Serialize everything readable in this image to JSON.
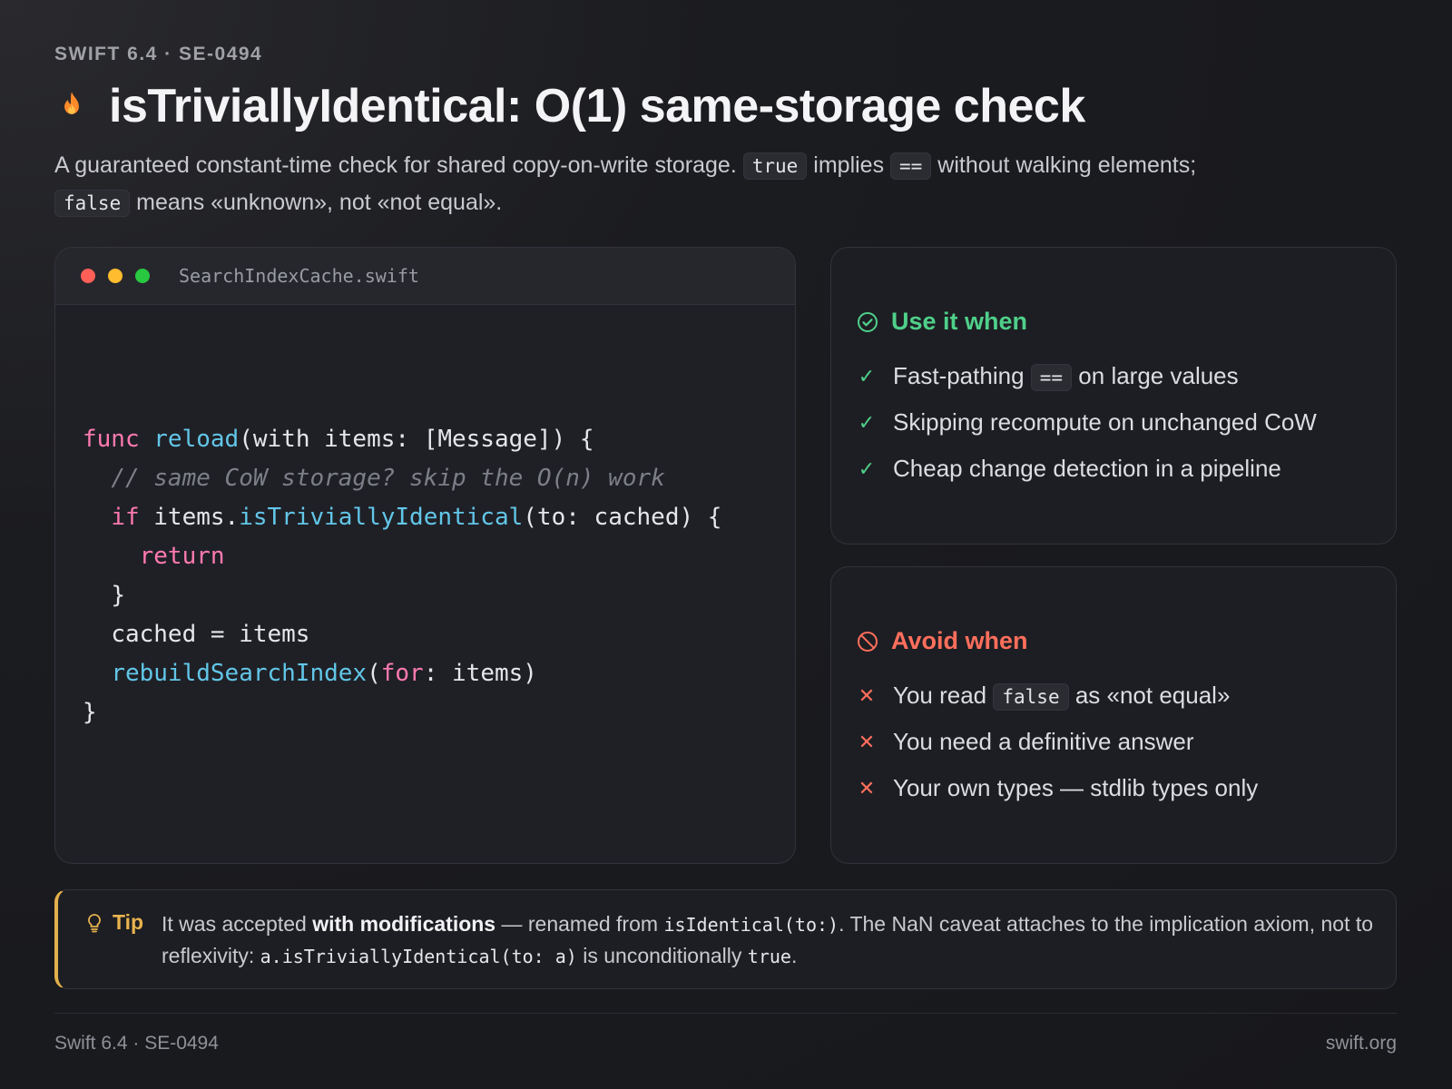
{
  "header": {
    "eyebrow": "SWIFT 6.4 · SE-0494",
    "title": "isTriviallyIdentical: O(1) same-storage check",
    "lede": {
      "part1": "A guaranteed constant-time check for shared copy-on-write storage.",
      "code1": "true",
      "part2": "implies",
      "code2": "==",
      "part3": "without walking elements;",
      "code3": "false",
      "part4": "means «unknown», not «not equal»."
    }
  },
  "code_window": {
    "filename": "SearchIndexCache.swift",
    "traffic_colors": [
      "#ff5f57",
      "#febc2e",
      "#28c840"
    ],
    "lines": {
      "l1_kw": "func",
      "l1_fn": "reload",
      "l1_rest": "(with items: [Message]) {",
      "l2_comment": "// same CoW storage? skip the O(n) work",
      "l3_kw": "if",
      "l3_pre": " items.",
      "l3_fn": "isTriviallyIdentical",
      "l3_rest": "(to: cached) {",
      "l4_kw": "return",
      "l5": "}",
      "l6": "cached = items",
      "l7_fn": "rebuildSearchIndex",
      "l7_open": "(",
      "l7_kw": "for",
      "l7_rest": ": items)",
      "l8": "}"
    }
  },
  "use_panel": {
    "heading": "Use it when",
    "icon": "check-circle-icon",
    "color": "#4fd08a",
    "items": [
      {
        "before": "Fast-pathing",
        "code": "==",
        "after": "on large values"
      },
      {
        "text": "Skipping recompute on unchanged CoW"
      },
      {
        "text": "Cheap change detection in a pipeline"
      }
    ]
  },
  "avoid_panel": {
    "heading": "Avoid when",
    "icon": "ban-icon",
    "color": "#ff6f5c",
    "items": [
      {
        "before": "You read",
        "code": "false",
        "after": "as «not equal»"
      },
      {
        "text": "You need a definitive answer"
      },
      {
        "text": "Your own types — stdlib types only"
      }
    ]
  },
  "tip": {
    "label": "Tip",
    "icon": "lightbulb-icon",
    "t1": "It was accepted ",
    "bold": "with modifications",
    "t2": " — renamed from ",
    "code1": "isIdentical(to:)",
    "t3": ". The NaN caveat attaches to the implication axiom, not to reflexivity: ",
    "code2": "a.isTriviallyIdentical(to: a)",
    "t4": " is unconditionally ",
    "code3": "true",
    "t5": "."
  },
  "footer": {
    "left": "Swift 6.4 · SE-0494",
    "right": "swift.org"
  }
}
